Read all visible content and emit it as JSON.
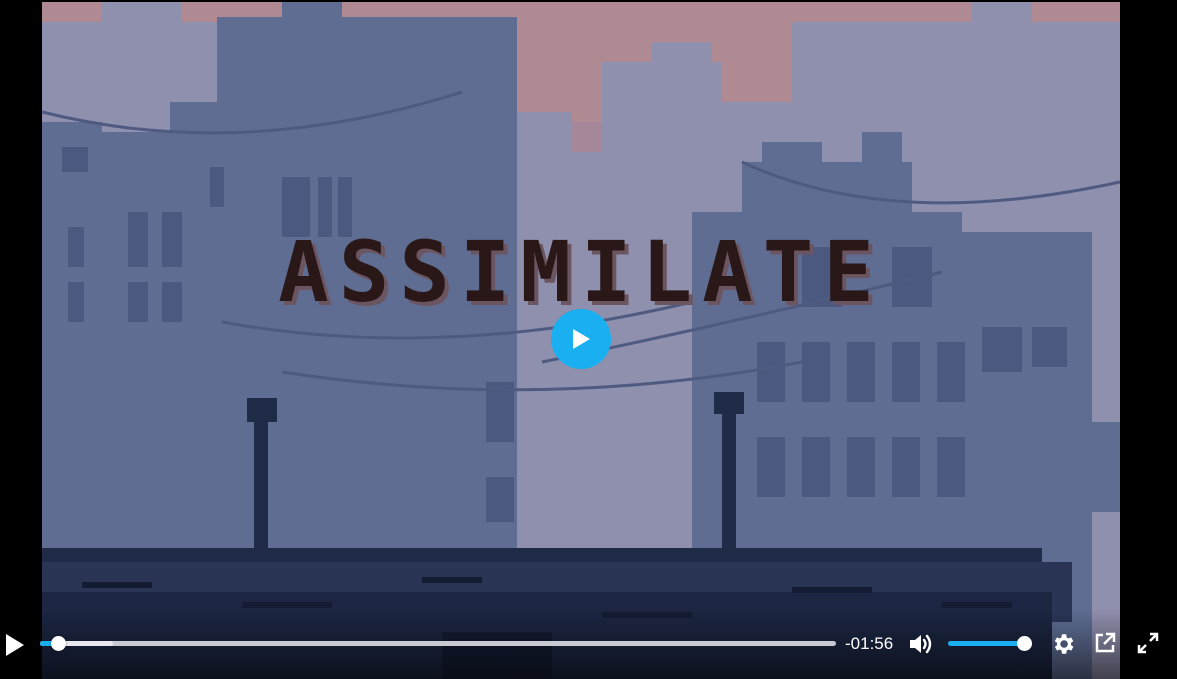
{
  "video": {
    "title_overlay": "ASSIMILATE",
    "time_remaining": "-01:56",
    "progress_fraction": 0.022,
    "buffered_fraction": 0.092,
    "volume_fraction": 1.0
  },
  "controls": {
    "play_icon": "play-icon",
    "big_play_icon": "big-play-icon",
    "mute_icon": "volume-icon",
    "settings_icon": "gear-icon",
    "pip_icon": "pop-out-icon",
    "fullscreen_icon": "fullscreen-icon"
  },
  "colors": {
    "accent": "#1aaff0",
    "sky": "#b08a93",
    "buildings_far": "#8a8fae",
    "buildings_mid": "#5e6c92",
    "ground": "#1f2a47"
  }
}
